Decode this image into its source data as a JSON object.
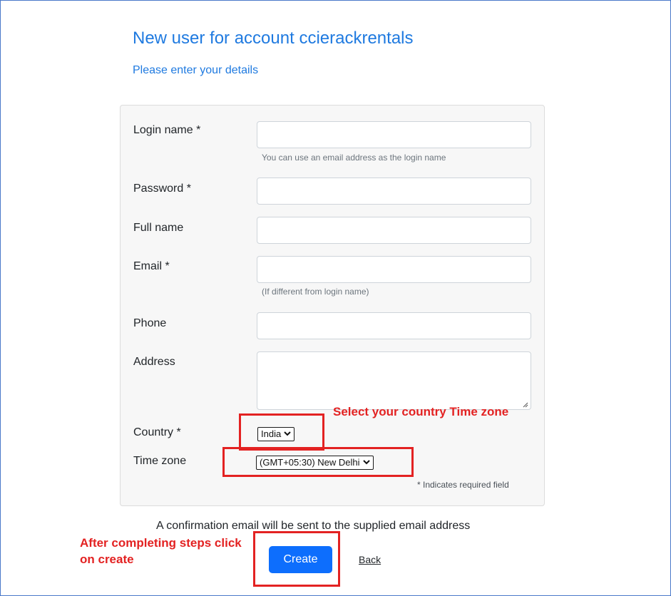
{
  "header": {
    "title": "New user for account ccierackrentals",
    "subtitle": "Please enter your details"
  },
  "form": {
    "login_name": {
      "label": "Login name *",
      "value": "",
      "help": "You can use an email address as the login name"
    },
    "password": {
      "label": "Password *",
      "value": ""
    },
    "full_name": {
      "label": "Full name",
      "value": ""
    },
    "email": {
      "label": "Email *",
      "value": "",
      "help": "(If different from login name)"
    },
    "phone": {
      "label": "Phone",
      "value": ""
    },
    "address": {
      "label": "Address",
      "value": ""
    },
    "country": {
      "label": "Country *",
      "selected": "India",
      "icon": "chevron-down-icon"
    },
    "time_zone": {
      "label": "Time zone",
      "selected": "(GMT+05:30) New Delhi",
      "icon": "chevron-down-icon"
    },
    "required_note": "* Indicates required field"
  },
  "footer": {
    "confirmation": "A confirmation email will be sent to the supplied email address",
    "create_label": "Create",
    "back_label": "Back"
  },
  "annotations": {
    "timezone_hint": "Select your country Time zone",
    "create_hint": "After completing steps click on create",
    "color": "#e32222"
  },
  "colors": {
    "title": "#1f7ae0",
    "primary_button": "#0d6efd"
  }
}
